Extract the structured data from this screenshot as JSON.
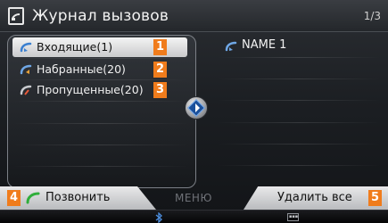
{
  "header": {
    "title": "Журнал вызовов",
    "page_indicator": "1/3"
  },
  "call_list": {
    "items": [
      {
        "label": "Входящие(1)",
        "badge": "1",
        "icon": "incoming-call-icon",
        "selected": true
      },
      {
        "label": "Набранные(20)",
        "badge": "2",
        "icon": "outgoing-call-icon",
        "selected": false
      },
      {
        "label": "Пропущенные(20)",
        "badge": "3",
        "icon": "missed-call-icon",
        "selected": false
      }
    ]
  },
  "detail": {
    "entry_name": "NAME 1",
    "entry_icon": "incoming-call-icon"
  },
  "bottom_bar": {
    "call_label": "Позвонить",
    "call_badge": "4",
    "menu_label": "МЕНЮ",
    "delete_label": "Удалить все",
    "delete_badge": "5"
  },
  "status_bar": {
    "icons": [
      "bluetooth-icon",
      "media-icon"
    ]
  },
  "colors": {
    "badge": "#f07c1c",
    "phone_icon_blue": "#6fa7e6",
    "call_icon_green": "#2fae3a"
  }
}
